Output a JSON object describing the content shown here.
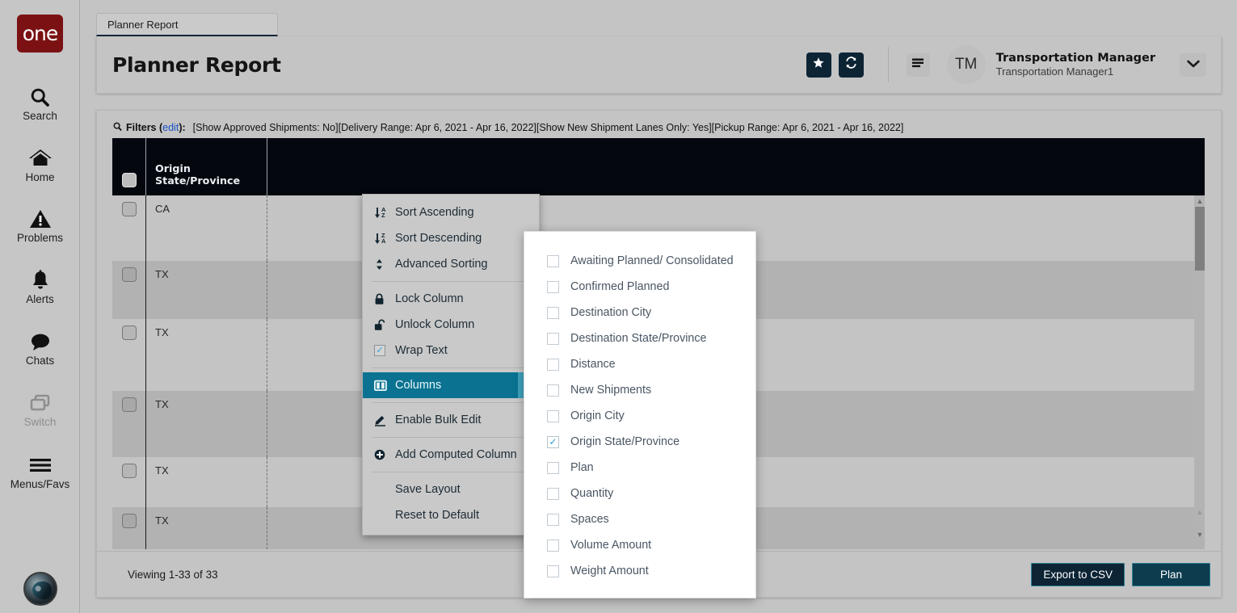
{
  "brand": {
    "logo_text": "one"
  },
  "rail": {
    "items": [
      {
        "label": "Search",
        "icon": "search-icon",
        "disabled": false
      },
      {
        "label": "Home",
        "icon": "home-icon",
        "disabled": false
      },
      {
        "label": "Problems",
        "icon": "warning-icon",
        "disabled": false
      },
      {
        "label": "Alerts",
        "icon": "bell-icon",
        "disabled": false
      },
      {
        "label": "Chats",
        "icon": "chat-icon",
        "disabled": false
      },
      {
        "label": "Switch",
        "icon": "switch-icon",
        "disabled": true
      },
      {
        "label": "Menus/Favs",
        "icon": "hamburger-icon",
        "disabled": false
      }
    ]
  },
  "tab": {
    "label": "Planner Report"
  },
  "header": {
    "title": "Planner Report",
    "favorite_icon": "star-icon",
    "refresh_icon": "refresh-icon",
    "menu_icon": "hamburger-icon",
    "caret_icon": "chevron-down-icon",
    "user": {
      "initials": "TM",
      "name": "Transportation Manager",
      "subtitle": "Transportation Manager1"
    }
  },
  "filters": {
    "icon": "search-icon",
    "label": "Filters (",
    "edit": "edit",
    "label_end": "):",
    "value": "[Show Approved Shipments: No][Delivery Range: Apr 6, 2021 - Apr 16, 2022][Show New Shipment Lanes Only: Yes][Pickup Range: Apr 6, 2021 - Apr 16, 2022]"
  },
  "table": {
    "columns": [
      "Origin State/Province"
    ],
    "rows": [
      {
        "origin_state": "CA"
      },
      {
        "origin_state": "TX"
      },
      {
        "origin_state": "TX"
      },
      {
        "origin_state": "TX"
      },
      {
        "origin_state": "TX"
      },
      {
        "origin_state": "TX"
      }
    ]
  },
  "footer": {
    "viewing": "Viewing 1-33 of 33",
    "export_label": "Export to CSV",
    "plan_label": "Plan"
  },
  "context_menu": {
    "items": [
      {
        "label": "Sort Ascending",
        "icon": "sort-ascending-icon",
        "type": "item"
      },
      {
        "label": "Sort Descending",
        "icon": "sort-descending-icon",
        "type": "item"
      },
      {
        "label": "Advanced Sorting",
        "icon": "sort-updown-icon",
        "type": "submenu"
      },
      {
        "type": "divider"
      },
      {
        "label": "Lock Column",
        "icon": "lock-icon",
        "type": "item"
      },
      {
        "label": "Unlock Column",
        "icon": "unlock-icon",
        "type": "item"
      },
      {
        "label": "Wrap Text",
        "icon": "checkbox-icon",
        "type": "checkbox",
        "checked": true
      },
      {
        "type": "divider"
      },
      {
        "label": "Columns",
        "icon": "columns-icon",
        "type": "submenu",
        "selected": true
      },
      {
        "type": "divider"
      },
      {
        "label": "Enable Bulk Edit",
        "icon": "edit-icon",
        "type": "item"
      },
      {
        "type": "divider"
      },
      {
        "label": "Add Computed Column",
        "icon": "plus-circle-icon",
        "type": "item"
      },
      {
        "type": "divider"
      },
      {
        "label": "Save Layout",
        "icon": "",
        "type": "plain"
      },
      {
        "label": "Reset to Default",
        "icon": "",
        "type": "plain"
      }
    ]
  },
  "columns_submenu": {
    "items": [
      {
        "label": "Awaiting Planned/ Consolidated",
        "checked": false
      },
      {
        "label": "Confirmed Planned",
        "checked": false
      },
      {
        "label": "Destination City",
        "checked": false
      },
      {
        "label": "Destination State/Province",
        "checked": false
      },
      {
        "label": "Distance",
        "checked": false
      },
      {
        "label": "New Shipments",
        "checked": false
      },
      {
        "label": "Origin City",
        "checked": false
      },
      {
        "label": "Origin State/Province",
        "checked": true
      },
      {
        "label": "Plan",
        "checked": false
      },
      {
        "label": "Quantity",
        "checked": false
      },
      {
        "label": "Spaces",
        "checked": false
      },
      {
        "label": "Volume Amount",
        "checked": false
      },
      {
        "label": "Weight Amount",
        "checked": false
      }
    ]
  },
  "colors": {
    "brand_red": "#7b1113",
    "navy": "#0d2435",
    "teal": "#0b7391",
    "teal_light": "#3fa3bd",
    "link_blue": "#1651c8",
    "check_blue": "#2e9fd6",
    "page_bg": "#c4c4c4",
    "header_dark": "#05070f"
  }
}
